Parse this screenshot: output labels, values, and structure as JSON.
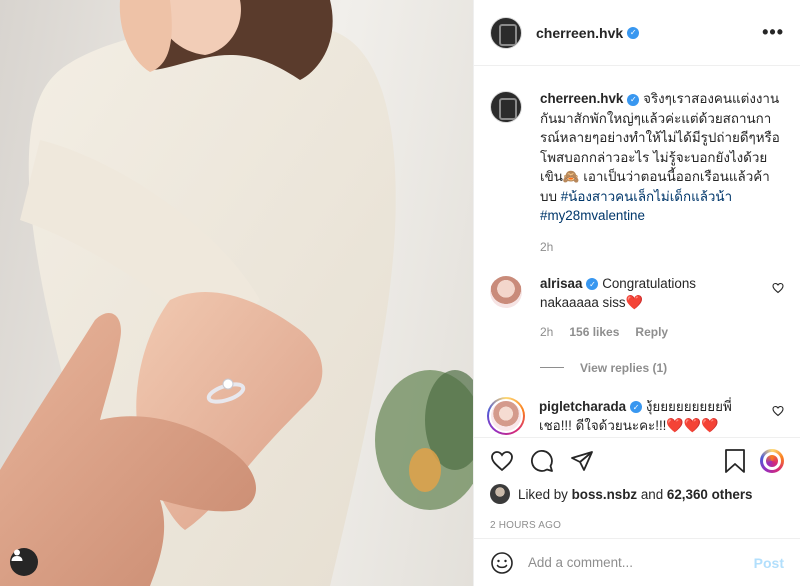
{
  "post": {
    "author": "cherreen.hvk",
    "more_label": "•••",
    "caption": {
      "username": "cherreen.hvk",
      "text": "จริงๆเราสองคนแต่งงานกันมาสักพักใหญ่ๆแล้วค่ะแต่ด้วยสถานการณ์หลายๆอย่างทำให้ไม่ได้มีรูปถ่ายดีๆหรือโพสบอกกล่าวอะไร ไม่รู้จะบอกยังไงด้วย เขิน🙈 เอาเป็นว่าตอนนี้ออกเรือนแล้วค้าบบ",
      "hashtag1": "#น้องสาวคนเล็กไม่เด็กแล้วน้า",
      "hashtag2": "#my28mvalentine",
      "time": "2h"
    },
    "comments": [
      {
        "username": "alrisaa",
        "text": "Congratulations nakaaaaa siss",
        "emoji": "❤️",
        "time": "2h",
        "likes": "156 likes",
        "reply_label": "Reply",
        "view_replies": "View replies (1)"
      },
      {
        "username": "pigletcharada",
        "text": "งุ้ยยยยยยยยยพี่เชอ!!! ดีใจด้วยนะคะ!!!",
        "emoji": "❤️❤️❤️"
      }
    ],
    "liked_by_prefix": "Liked by",
    "liked_by_user": "boss.nsbz",
    "liked_by_and": "and",
    "liked_by_count": "62,360 others",
    "timestamp": "2 HOURS AGO",
    "add_comment_placeholder": "Add a comment...",
    "post_button": "Post"
  },
  "icons": {
    "like": "heart-outline-icon",
    "comment": "comment-bubble-icon",
    "share": "paper-plane-icon",
    "save": "bookmark-icon",
    "emoji": "smiley-icon",
    "more": "ellipsis-icon",
    "user": "user-icon"
  },
  "colors": {
    "verified": "#3897f0",
    "hashtag": "#00376b",
    "muted": "#8e8e8e",
    "post_disabled": "#b2dffc",
    "heart": "#ed4956"
  }
}
